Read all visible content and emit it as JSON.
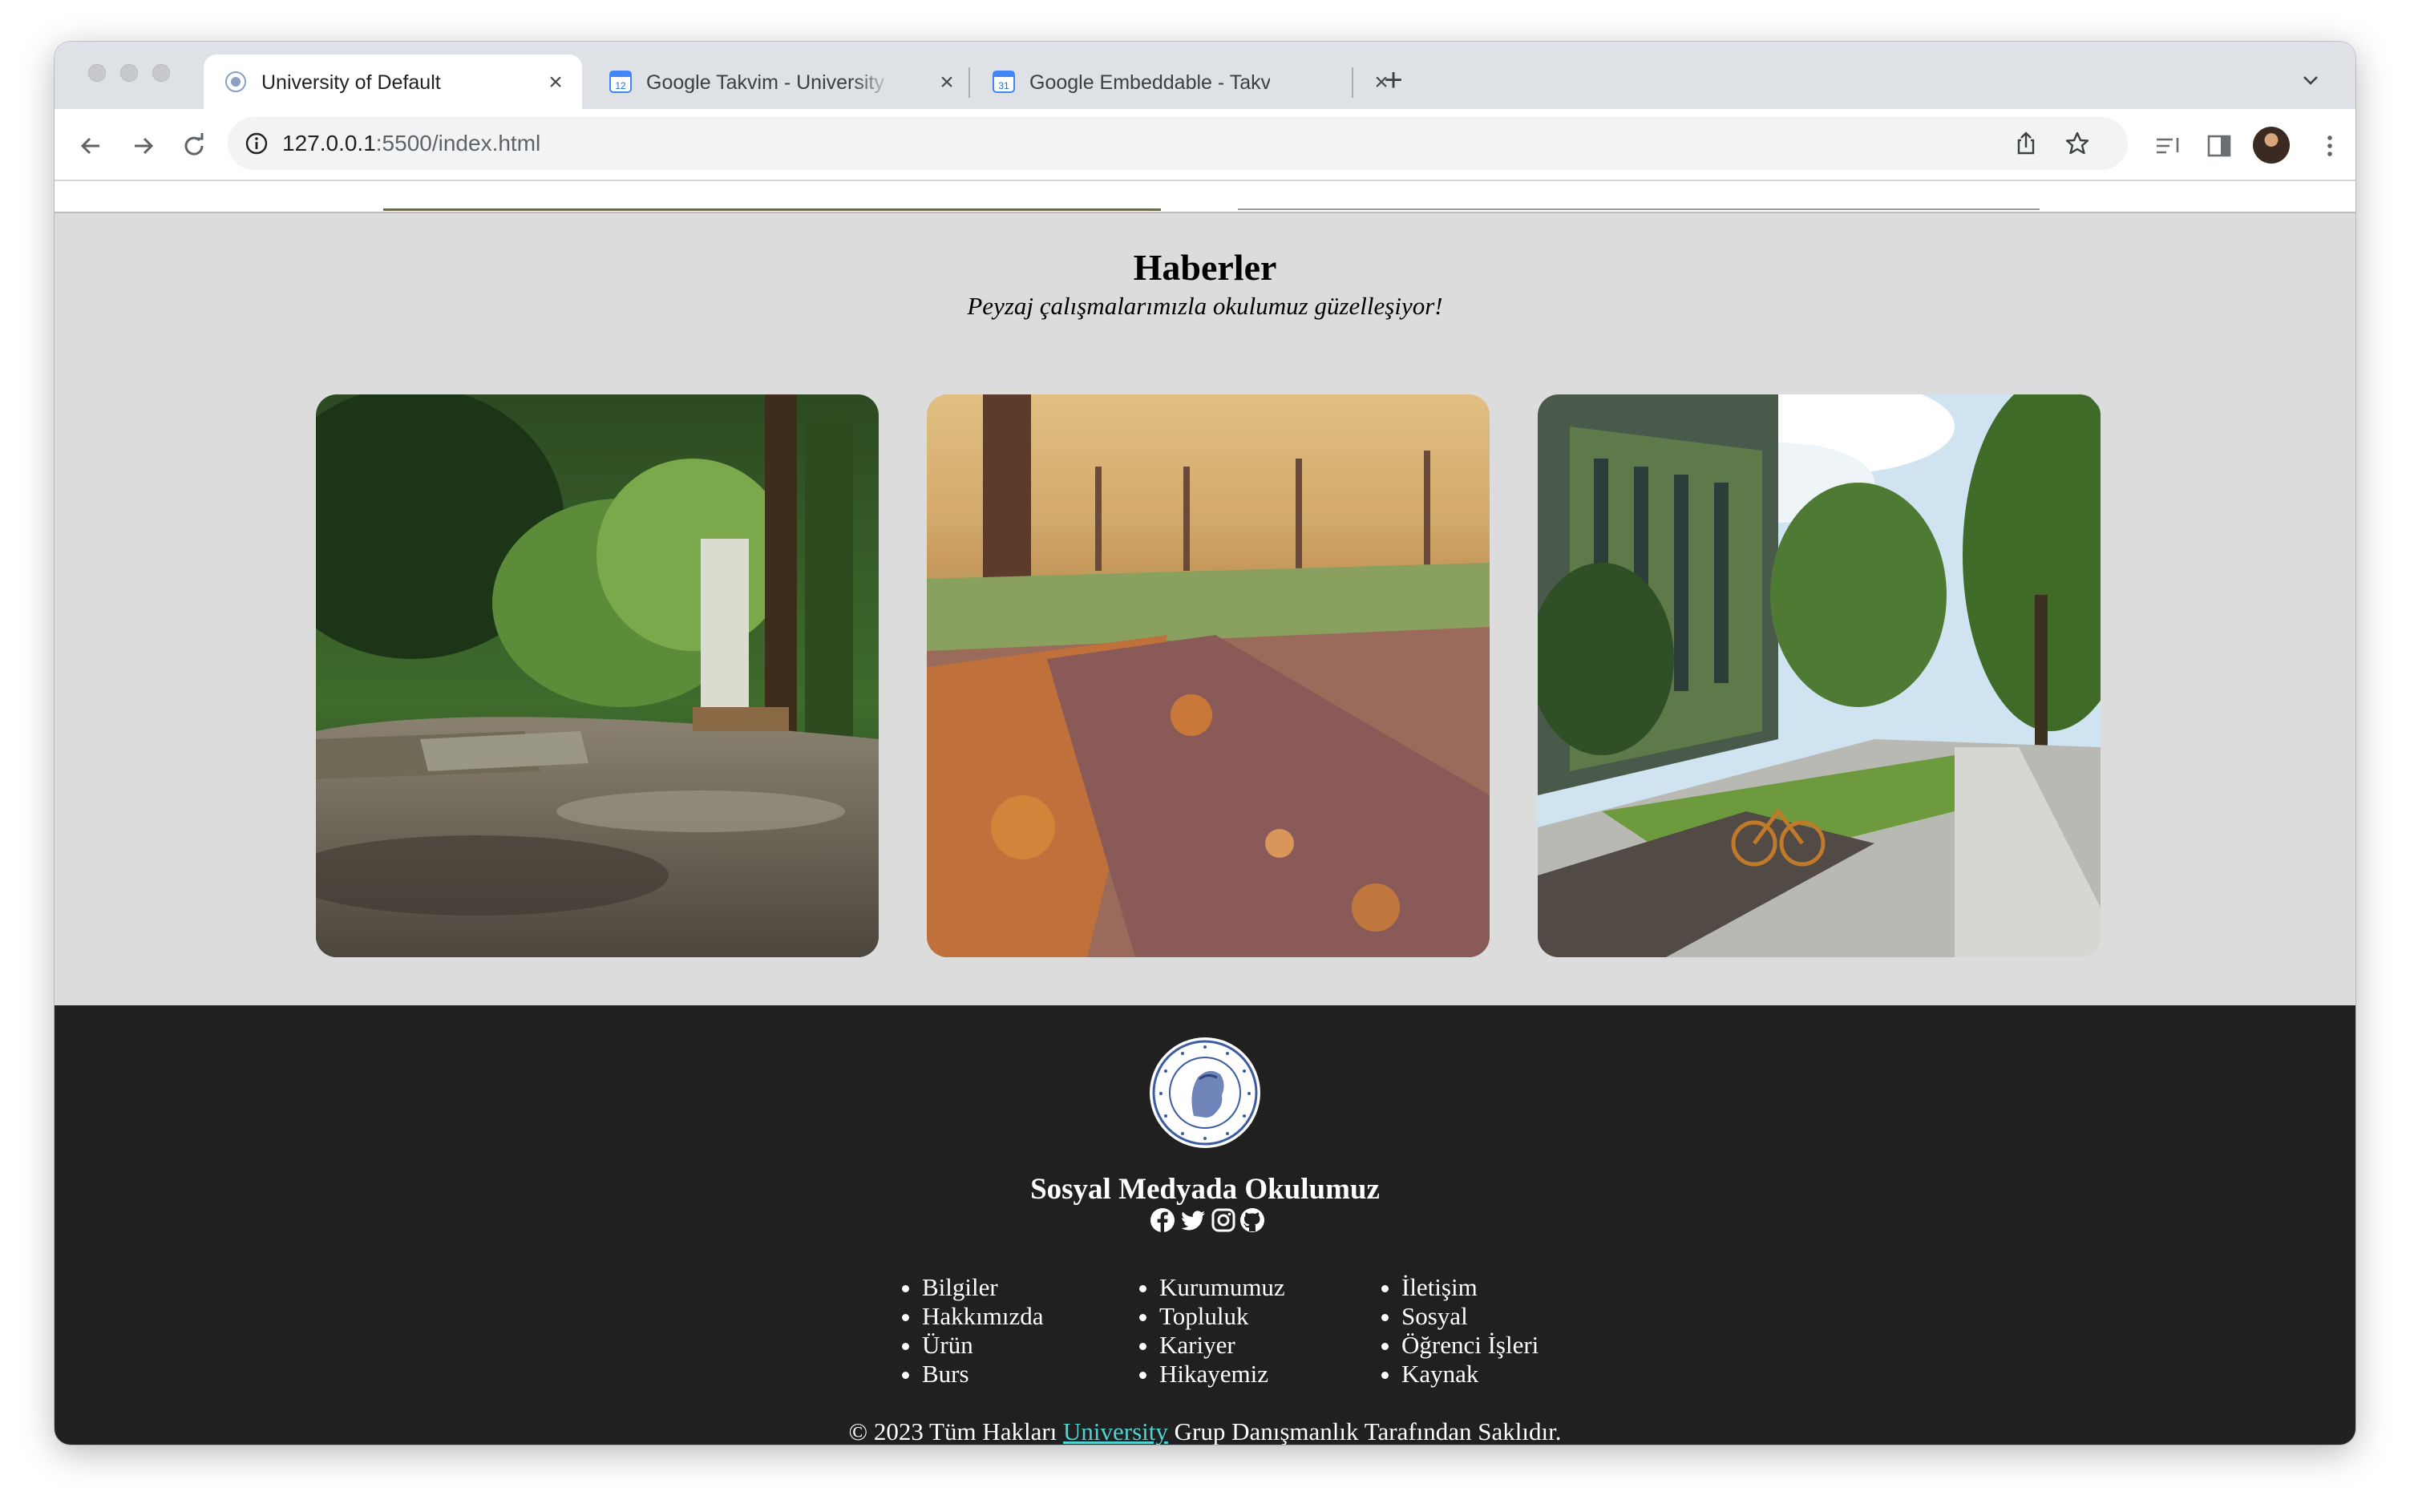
{
  "browser": {
    "tabs": [
      {
        "title": "University of Default",
        "active": true
      },
      {
        "title": "Google Takvim - University için",
        "active": false
      },
      {
        "title": "Google Embeddable - Takvim",
        "active": false
      }
    ],
    "new_tab_symbol": "+",
    "close_symbol": "×",
    "url": {
      "host": "127.0.0.1",
      "rest": ":5500/index.html"
    }
  },
  "news": {
    "title": "Haberler",
    "subtitle": "Peyzaj çalışmalarımızla okulumuz güzelleşiyor!",
    "photos": [
      {
        "subject": "garden path with plants"
      },
      {
        "subject": "autumn leaves on dirt path"
      },
      {
        "subject": "ivy-covered campus building with bicycle"
      }
    ]
  },
  "footer": {
    "social_title": "Sosyal Medyada Okulumuz",
    "social_icons": [
      "facebook-icon",
      "twitter-icon",
      "instagram-icon",
      "github-icon"
    ],
    "link_columns": [
      [
        "Bilgiler",
        "Hakkımızda",
        "Ürün",
        "Burs"
      ],
      [
        "Kurumumuz",
        "Topluluk",
        "Kariyer",
        "Hikayemiz"
      ],
      [
        "İletişim",
        "Sosyal",
        "Öğrenci İşleri",
        "Kaynak"
      ]
    ],
    "copyright": {
      "before": "© 2023 Tüm Hakları ",
      "link": "University",
      "after": " Grup Danışmanlık Tarafından Saklıdır."
    }
  },
  "colors": {
    "page_bg": "#dcdcdc",
    "footer_bg": "#202020",
    "link": "#4fd4d4"
  }
}
